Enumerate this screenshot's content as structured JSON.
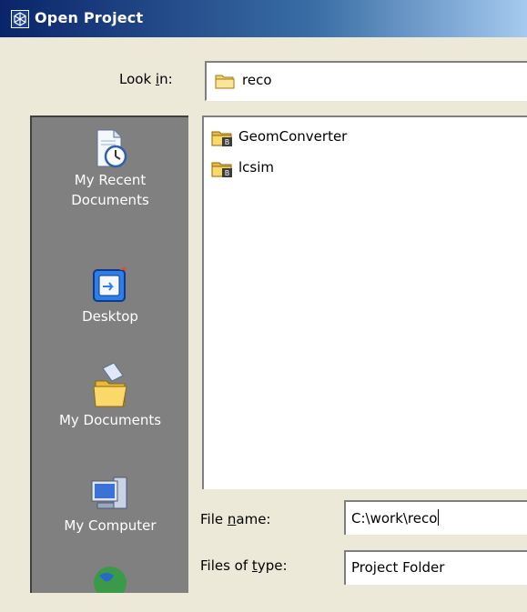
{
  "window": {
    "title": "Open Project"
  },
  "look_in": {
    "label_pre": "Look ",
    "label_accel": "i",
    "label_post": "n:",
    "value": "reco"
  },
  "places": [
    {
      "label_line1": "My Recent",
      "label_line2": "Documents",
      "icon": "recent-documents-icon"
    },
    {
      "label_line1": "Desktop",
      "label_line2": "",
      "icon": "desktop-icon"
    },
    {
      "label_line1": "My Documents",
      "label_line2": "",
      "icon": "my-documents-icon"
    },
    {
      "label_line1": "My Computer",
      "label_line2": "",
      "icon": "my-computer-icon"
    },
    {
      "label_line1": "",
      "label_line2": "",
      "icon": "network-places-icon"
    }
  ],
  "files": [
    {
      "name": "GeomConverter",
      "icon": "project-folder-icon"
    },
    {
      "name": "lcsim",
      "icon": "project-folder-icon"
    }
  ],
  "file_name": {
    "label_pre": "File ",
    "label_accel": "n",
    "label_post": "ame:",
    "value": "C:\\work\\reco"
  },
  "file_type": {
    "label_pre": "Files of ",
    "label_accel": "t",
    "label_post": "ype:",
    "value": "Project Folder"
  },
  "colors": {
    "title_bar_start": "#0a246a",
    "title_bar_end": "#a6caf0",
    "dialog_background": "#ece9d8",
    "places_bar": "#808080"
  }
}
